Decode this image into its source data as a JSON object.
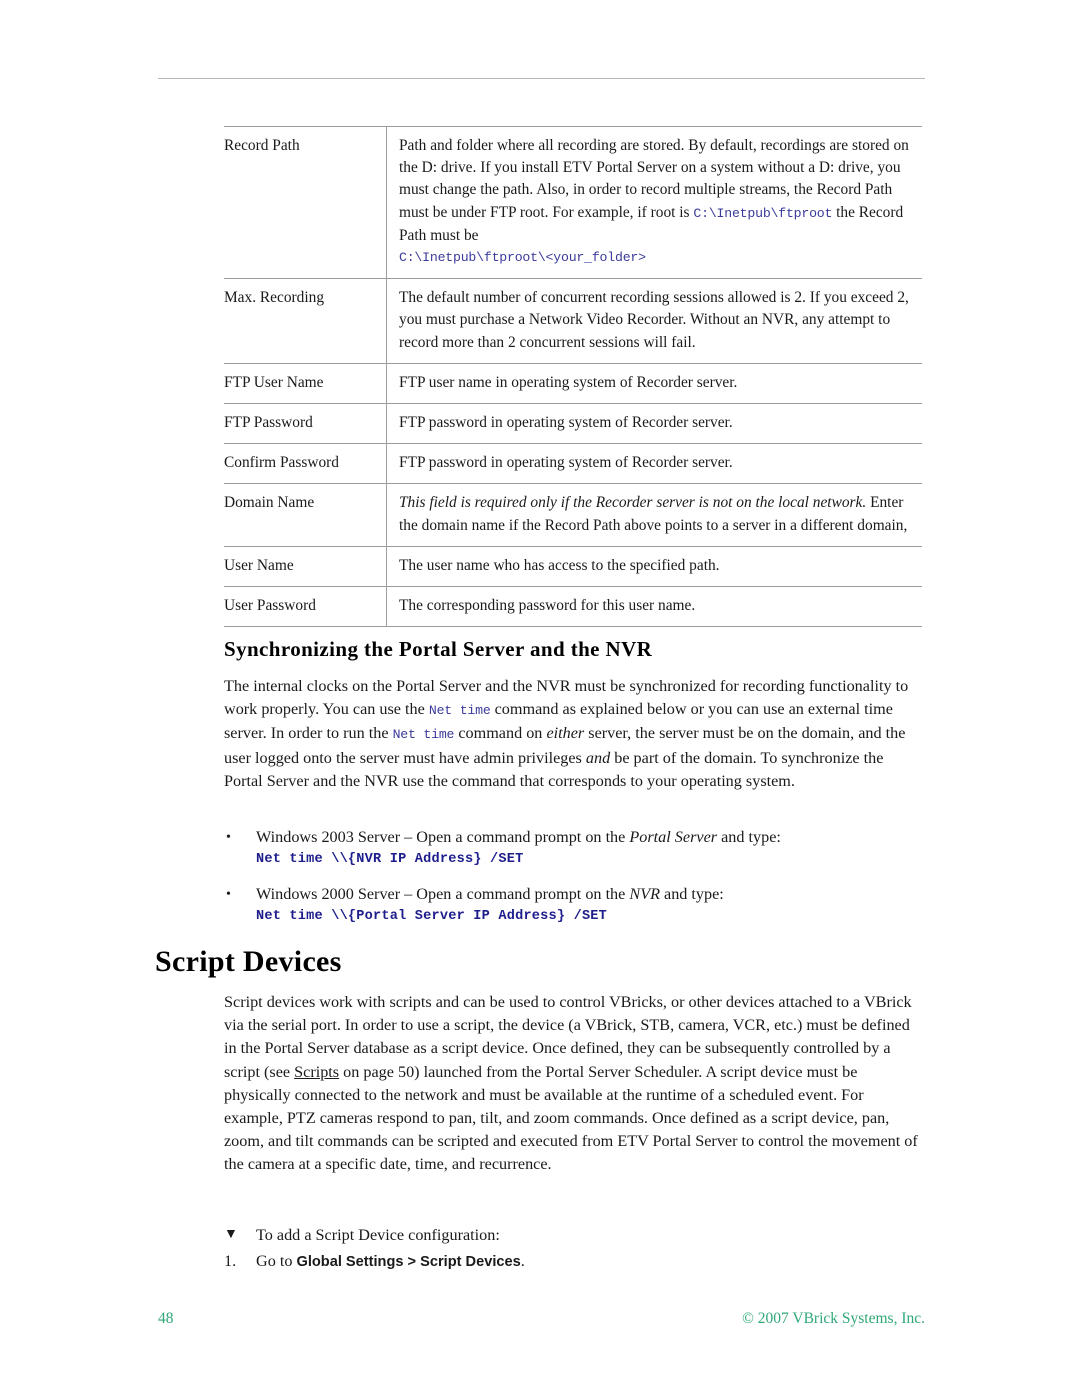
{
  "document": {
    "page_number": "48",
    "copyright": "© 2007 VBrick Systems, Inc."
  },
  "spec_table": {
    "rows": [
      {
        "term": "Record Path",
        "desc_lead": "Path and folder where all recording are stored. By default, recordings are stored on the D: drive. If you install ETV Portal Server on a system without a D: drive, you must change the path. Also, in order to record multiple streams, the Record Path must be under FTP root. For example, if root is ",
        "desc_code_inline": "C:\\Inetpub\\ftproot",
        "desc_tail": " the Record Path must be",
        "desc_code_block": "C:\\Inetpub\\ftproot\\<your_folder>"
      },
      {
        "term": "Max. Recording",
        "desc": "The default number of concurrent recording sessions allowed is 2. If you exceed 2, you must purchase a Network Video Recorder. Without an NVR, any attempt to record more than 2 concurrent sessions will fail."
      },
      {
        "term": "FTP User Name",
        "desc": "FTP user name in operating system of Recorder server."
      },
      {
        "term": "FTP Password",
        "desc": "FTP password in operating system of Recorder server."
      },
      {
        "term": "Confirm Password",
        "desc": "FTP password in operating system of Recorder server."
      },
      {
        "term": "Domain Name",
        "desc_italic": "This field is required only if the Recorder server is not on the local network.",
        "desc_rest": " Enter the domain name if the Record Path above points to a server in a different domain,"
      },
      {
        "term": "User Name",
        "desc": "The user name who has access to the specified path."
      },
      {
        "term": "User Password",
        "desc": "The corresponding password for this user name."
      }
    ]
  },
  "sync_section": {
    "heading": "Synchronizing the Portal Server and the NVR",
    "para_1": "The internal clocks on the Portal Server and the NVR must be synchronized for recording functionality to work properly. You can use the ",
    "cmd_inline_1": "Net time",
    "para_2": " command as explained below or you can use an external time server. In order to run the ",
    "cmd_inline_2": "Net time",
    "para_3": " command on ",
    "para_either": "either",
    "para_4": " server, the server must be on the domain, and the user logged onto the server must have admin privileges ",
    "para_and": "and",
    "para_5": " be part of the domain. To synchronize the Portal Server and the NVR use the command that corresponds to your operating system.",
    "bullets": [
      {
        "marker": "•",
        "text_lead": "Windows 2003 Server – Open a command prompt on the ",
        "text_italic": "Portal Server",
        "text_tail": " and type:",
        "command": "Net time \\\\{NVR IP Address} /SET"
      },
      {
        "marker": "•",
        "text_lead": "Windows 2000 Server – Open a command prompt on the ",
        "text_italic": "NVR",
        "text_tail": " and type:",
        "command": "Net time \\\\{Portal Server IP Address} /SET"
      }
    ]
  },
  "script_devices_section": {
    "heading": "Script Devices",
    "para_lead": "Script devices work with scripts and can be used to control VBricks, or other devices attached to a VBrick via the serial port. In order to use a script, the device (a VBrick, STB, camera, VCR, etc.) must be defined in the Portal Server database as a script device. Once defined, they can be subsequently controlled by a script (see ",
    "xref_label": "Scripts",
    "para_mid": " on page 50) launched from the Portal Server Scheduler. A script device must be physically connected to the network and must be available at the runtime of a scheduled event. For example, PTZ cameras respond to pan, tilt, and zoom commands. Once defined as a script device, pan, zoom, and tilt commands can be scripted and executed from ETV Portal Server to control the movement of the camera at a specific date, time, and recurrence.",
    "procedure": {
      "intro_marker": "▼",
      "intro_text": "To add a Script Device configuration:",
      "steps": [
        {
          "marker": "1.",
          "text_lead": "Go to ",
          "text_bold": "Global Settings > Script Devices",
          "text_tail": "."
        }
      ]
    }
  },
  "colors": {
    "code_blue": "#3b3b9c",
    "command_blue": "#1d1d8c",
    "footer_green": "#2fa877",
    "rule_gray": "#9b9b9b"
  }
}
